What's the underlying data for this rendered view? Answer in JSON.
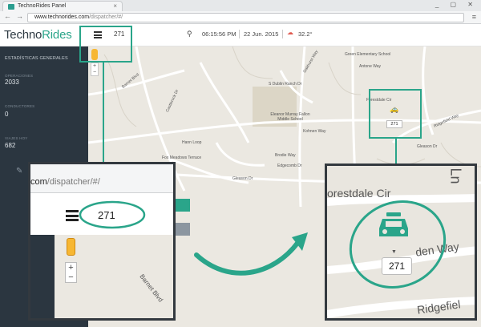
{
  "browser": {
    "tab_title": "TechnoRides Panel",
    "url_domain": "www.technorides.com",
    "url_path": "/dispatcher/#/"
  },
  "header": {
    "logo_main": "Techno",
    "logo_accent": "Rides",
    "dispatch_number": "271",
    "time": "06:15:56 PM",
    "date": "22 Jun. 2015",
    "temperature": "32.2°"
  },
  "sidebar": {
    "title": "ESTADÍSTICAS GENERALES",
    "stats": [
      {
        "label": "OPERACIONES",
        "value": "2033"
      },
      {
        "label": "CONDUCTORES",
        "value": "0"
      },
      {
        "label": "VIAJES HOY",
        "value": "682"
      }
    ]
  },
  "map": {
    "labels": {
      "green_school": "Green Elementary School",
      "antone": "Antone Way",
      "dublin_ranch": "S Dublin Ranch Dr",
      "eleanor": "Eleanor Murray Fallon Middle School",
      "kohnen": "Kohnen Way",
      "forestdale": "Forestdale Cir",
      "gleason": "Gleason Dr",
      "gleason2": "Gleason Dr",
      "barnet": "Barnet Blvd",
      "castlerock": "Castlerock Dr",
      "hanna": "Hann Loop",
      "ridgefield": "Ridgefield Way",
      "edgecomb": "Edgecomb Dr",
      "brodie": "Brodie Way",
      "terrace": "Fox Meadows Terrace",
      "oakhurst": "Oakhurst Way"
    },
    "taxi_number": "271",
    "zoom_plus": "+",
    "zoom_minus": "−"
  },
  "zoom_left": {
    "url_domain": "com",
    "url_path": "/dispatcher/#/",
    "dispatch_number": "271",
    "road": "Barnet Blvd",
    "zoom_plus": "+",
    "zoom_minus": "−"
  },
  "zoom_right": {
    "label_forestdale": "orestdale Cir",
    "label_way": "den Way",
    "label_ridgefield": "Ridgefiel",
    "label_ln": "Ln",
    "taxi_number": "271"
  },
  "colors": {
    "accent": "#2aa58a",
    "sidebar": "#2b3640",
    "map_bg": "#ebe8e1"
  }
}
